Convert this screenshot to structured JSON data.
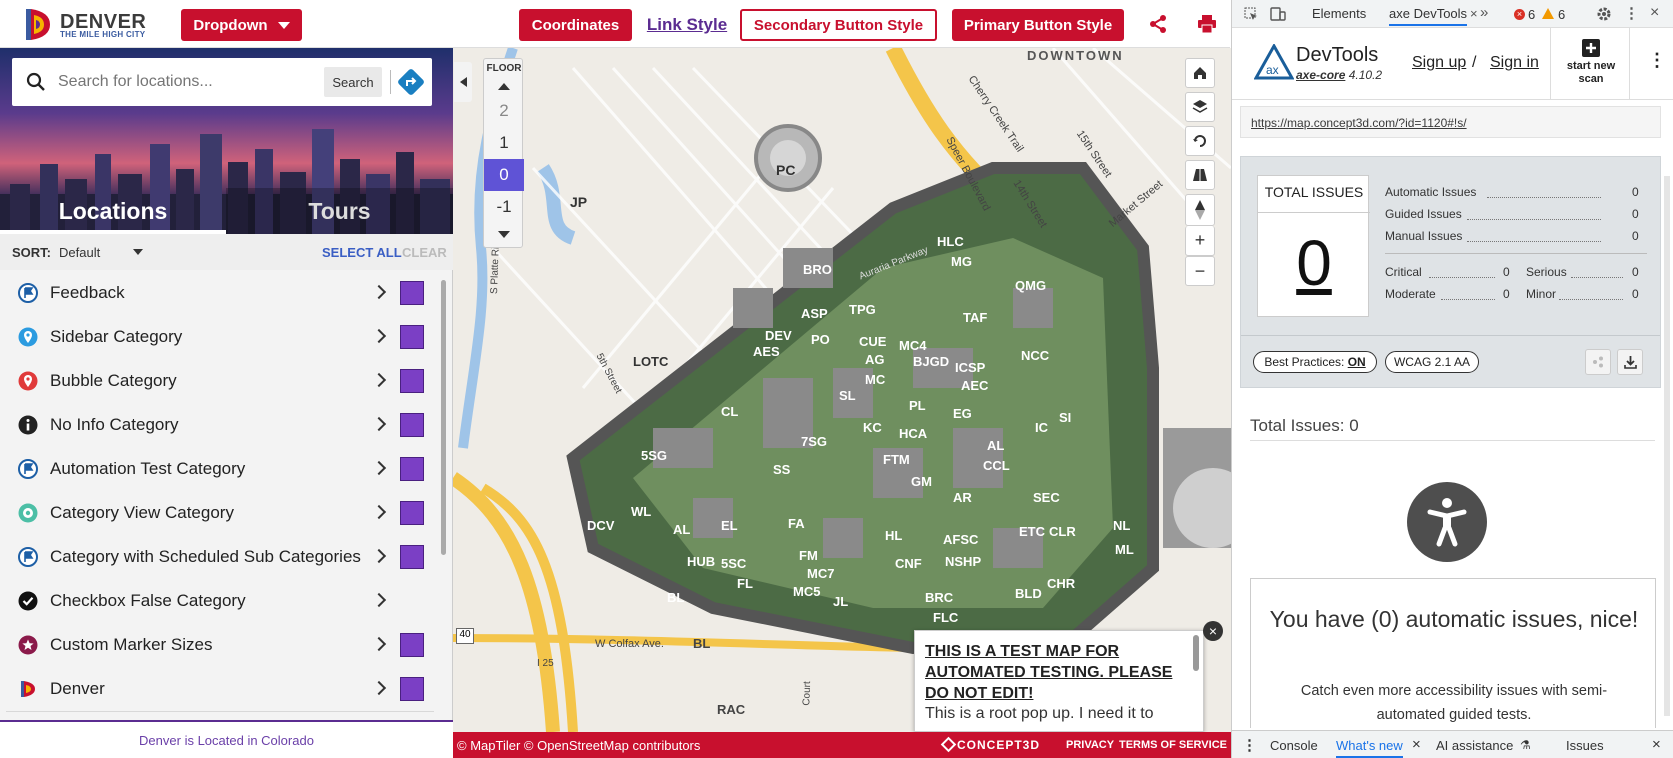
{
  "header": {
    "logo_name": "DENVER",
    "logo_tagline": "THE MILE HIGH CITY",
    "dropdown_label": "Dropdown",
    "coordinates_label": "Coordinates",
    "link_style_label": "Link Style",
    "secondary_label": "Secondary Button Style",
    "primary_label": "Primary Button Style",
    "brand_color": "#c8102e"
  },
  "sidebar": {
    "search_placeholder": "Search for locations...",
    "search_button": "Search",
    "tabs": [
      {
        "label": "Locations",
        "active": true
      },
      {
        "label": "Tours",
        "active": false
      }
    ],
    "sort_label": "SORT:",
    "sort_value": "Default",
    "select_all": "SELECT ALL",
    "clear": "CLEAR",
    "categories": [
      {
        "label": "Feedback",
        "icon": "flag-icon",
        "checked": true
      },
      {
        "label": "Sidebar Category",
        "icon": "pin-icon",
        "checked": true
      },
      {
        "label": "Bubble Category",
        "icon": "marker-icon",
        "checked": true
      },
      {
        "label": "No Info Category",
        "icon": "info-icon",
        "checked": true
      },
      {
        "label": "Automation Test Category",
        "icon": "flag-icon",
        "checked": true
      },
      {
        "label": "Category View Category",
        "icon": "pin-icon",
        "checked": true
      },
      {
        "label": "Category with Scheduled Sub Categories",
        "icon": "flag-icon",
        "checked": true
      },
      {
        "label": "Checkbox False Category",
        "icon": "check-icon",
        "checked": false
      },
      {
        "label": "Custom Marker Sizes",
        "icon": "star-icon",
        "checked": true
      },
      {
        "label": "Denver",
        "icon": "denver-icon",
        "checked": true
      }
    ],
    "footer": "Denver is Located in Colorado",
    "swatch_color": "#7b3fc5"
  },
  "map": {
    "floor_title": "FLOOR",
    "floors": [
      "2",
      "1",
      "0",
      "-1"
    ],
    "active_floor": "0",
    "labels": {
      "downtown": "DOWNTOWN",
      "colfax": "W Colfax Ave.",
      "buildings": [
        "PC",
        "JP",
        "BRO",
        "HLC",
        "MG",
        "QMG",
        "TPG",
        "ASP",
        "DEV",
        "PO",
        "AES",
        "CUE",
        "AG",
        "MC4",
        "BJGD",
        "TAF",
        "NCC",
        "ICSP",
        "AEC",
        "LOTC",
        "MC",
        "SL",
        "PL",
        "EG",
        "CL",
        "KC",
        "HCA",
        "AL",
        "IC",
        "SI",
        "7SG",
        "5SG",
        "FTM",
        "CCL",
        "SS",
        "GM",
        "AR",
        "SEC",
        "DCV",
        "WL",
        "AL",
        "EL",
        "FA",
        "HL",
        "ETC",
        "CLR",
        "NL",
        "HUB",
        "5SC",
        "FM",
        "AFSC",
        "MC7",
        "NSHP",
        "CNF",
        "ML",
        "FL",
        "MC5",
        "CHR",
        "BLD",
        "BL",
        "JL",
        "BRC",
        "FLC",
        "BL",
        "RAC"
      ],
      "streets": [
        "Cherry Creek Trail",
        "15th Street",
        "Speer Boulevard",
        "14th Street",
        "Market Street",
        "Auraria Parkway",
        "S Platte River",
        "5th Street",
        "Court"
      ]
    },
    "popup_heading": "THIS IS A TEST MAP FOR AUTOMATED TESTING. PLEASE DO NOT EDIT!",
    "popup_body": "This is a root pop up. I need it to",
    "attribution": "© MapTiler © OpenStreetMap contributors",
    "concept3d": "CONCEPT3D",
    "privacy": "PRIVACY",
    "terms": "TERMS OF SERVICE",
    "highway_sign": "40",
    "i25": "I 25"
  },
  "devtools": {
    "tabs": [
      "Elements",
      "axe DevTools"
    ],
    "error_count": "6",
    "warning_count": "6",
    "axe_title": "DevTools",
    "axe_core": "axe-core",
    "axe_version": "4.10.2",
    "sign_up": "Sign up",
    "slash": "/",
    "sign_in": "Sign in",
    "new_scan": "start new scan",
    "url": "https://map.concept3d.com/?id=1120#!s/",
    "total_issues_title": "TOTAL ISSUES",
    "total_issues": "0",
    "stats": [
      {
        "label": "Automatic Issues",
        "value": "0"
      },
      {
        "label": "Guided Issues",
        "value": "0"
      },
      {
        "label": "Manual Issues",
        "value": "0"
      }
    ],
    "severity": [
      {
        "label": "Critical",
        "value": "0"
      },
      {
        "label": "Serious",
        "value": "0"
      },
      {
        "label": "Moderate",
        "value": "0"
      },
      {
        "label": "Minor",
        "value": "0"
      }
    ],
    "best_practices": "Best Practices:",
    "best_practices_state": "ON",
    "wcag": "WCAG 2.1 AA",
    "total_issues_line": "Total Issues: 0",
    "nice_heading": "You have (0) automatic issues, nice!",
    "nice_body": "Catch even more accessibility issues with semi-automated guided tests.",
    "drawer": [
      "Console",
      "What's new",
      "AI assistance",
      "Issues"
    ]
  }
}
